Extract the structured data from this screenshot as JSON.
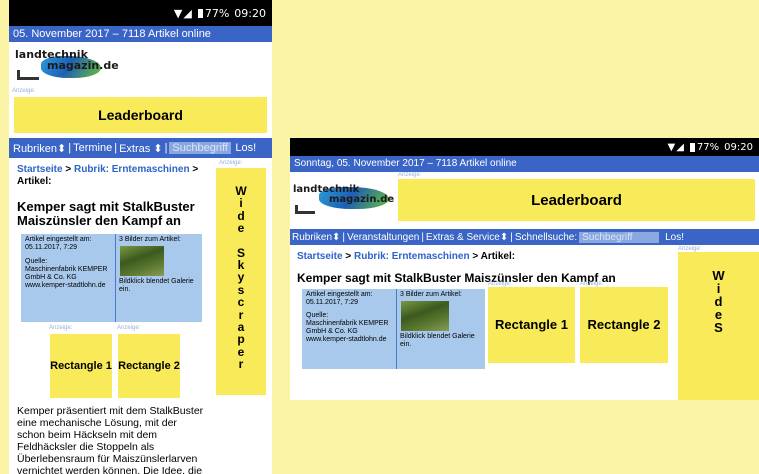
{
  "status": {
    "battery": "77%",
    "time": "09:20",
    "icons": "wifi-signal"
  },
  "portrait": {
    "topbar": "05. November 2017 – 7118 Artikel online",
    "logo": {
      "line1": "landtechnik",
      "line2": "magazin.de"
    },
    "anzeige": "Anzeige:",
    "leaderboard": "Leaderboard",
    "nav": {
      "rubriken": "Rubriken",
      "termine": "Termine",
      "extras": "Extras",
      "search_placeholder": "Suchbegriff",
      "go": "Los!"
    },
    "breadcrumb": {
      "home": "Startseite",
      "sep": " > ",
      "rubrik": "Rubrik: Erntemaschinen",
      "tail": " > Artikel:"
    },
    "title": "Kemper sagt mit StalkBuster Maiszünsler den Kampf an",
    "info": {
      "posted_label": "Artikel eingestellt am:",
      "posted_date": "05.11.2017, 7:29",
      "source_label": "Quelle:",
      "source": "Maschinenfabrik KEMPER GmbH & Co. KG",
      "url": "www.kemper-stadtlohn.de",
      "images_label": "3 Bilder zum Artikel:",
      "caption": "Bildklick blendet Galerie ein."
    },
    "rect1": "Rectangle 1",
    "rect2": "Rectangle 2",
    "skyscraper": [
      "W",
      "i",
      "d",
      "e",
      "",
      "S",
      "k",
      "y",
      "s",
      "c",
      "r",
      "a",
      "p",
      "e",
      "r"
    ],
    "body_lines": [
      "Kemper präsentiert mit dem StalkBuster",
      "eine mechanische Lösung, mit der",
      "schon beim Häckseln mit dem",
      "Feldhäcksler die Stoppeln als",
      "Überlebensraum für Maiszünslerlarven",
      "vernichtet werden können. Die Idee, die"
    ]
  },
  "landscape": {
    "topbar": "Sonntag, 05. November 2017 – 7118 Artikel online",
    "logo": {
      "line1": "landtechnik",
      "line2": "magazin.de"
    },
    "anzeige": "Anzeige:",
    "leaderboard": "Leaderboard",
    "nav": {
      "rubriken": "Rubriken",
      "veranstaltungen": "Veranstaltungen",
      "extras": "Extras & Service",
      "schnellsuche": "Schnellsuche:",
      "search_placeholder": "Suchbegriff",
      "go": "Los!"
    },
    "breadcrumb": {
      "home": "Startseite",
      "sep": " > ",
      "rubrik": "Rubrik: Erntemaschinen",
      "tail": " > Artikel:"
    },
    "title": "Kemper sagt mit StalkBuster Maiszünsler den Kampf an",
    "info": {
      "posted_label": "Artikel eingestellt am:",
      "posted_date": "05.11.2017, 7:29",
      "source_label": "Quelle:",
      "source": "Maschinenfabrik KEMPER GmbH & Co. KG",
      "url": "www.kemper-stadtlohn.de",
      "images_label": "3 Bilder zum Artikel:",
      "caption": "Bildklick blendet Galerie ein."
    },
    "rect1": "Rectangle 1",
    "rect2": "Rectangle 2",
    "skyscraper": [
      "W",
      "i",
      "d",
      "e",
      "S"
    ]
  },
  "colors": {
    "background": "#fbf4a6",
    "nav_blue": "#3a64c5",
    "ad_yellow": "#f9ea59",
    "link_blue": "#2e63c9",
    "infobox": "#a9c9ec"
  }
}
